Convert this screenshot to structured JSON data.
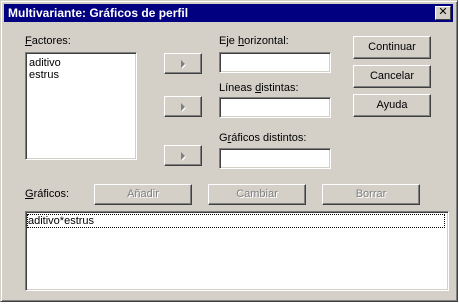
{
  "window": {
    "title": "Multivariante: Gráficos de perfil",
    "close_glyph": "✕"
  },
  "factores": {
    "label_accel": "F",
    "label_rest": "actores:",
    "items": [
      "aditivo",
      "estrus"
    ]
  },
  "eje_horizontal": {
    "label_pre": "Eje ",
    "label_accel": "h",
    "label_rest": "orizontal:",
    "value": ""
  },
  "lineas_distintas": {
    "label_pre": "Líneas ",
    "label_accel": "d",
    "label_rest": "istintas:",
    "value": ""
  },
  "graficos_distintos": {
    "label_pre": "G",
    "label_accel": "r",
    "label_rest": "áficos distintos:",
    "value": ""
  },
  "buttons": {
    "continuar": "Continuar",
    "cancelar": "Cancelar",
    "ayuda": "Ayuda"
  },
  "graficos": {
    "label_accel": "G",
    "label_rest": "ráficos:",
    "anadir": "Añadir",
    "cambiar": "Cambiar",
    "borrar": "Borrar",
    "items": [
      "aditivo*estrus"
    ]
  }
}
